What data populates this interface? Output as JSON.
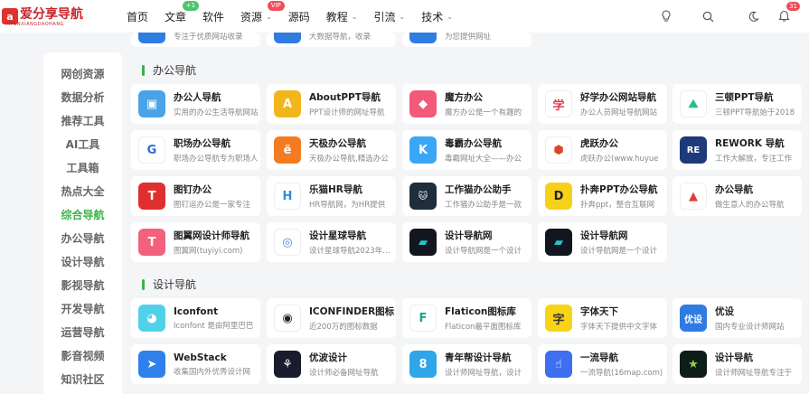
{
  "header": {
    "logo_text": "爱分享导航",
    "logo_sub": "AIFENXIANGDAOHANG",
    "nav": [
      {
        "label": "首页"
      },
      {
        "label": "文章",
        "badge": "+1",
        "badge_color": "#4cc66d"
      },
      {
        "label": "软件"
      },
      {
        "label": "资源",
        "badge": "VIP",
        "badge_color": "#ef4e5c",
        "chevron": true
      },
      {
        "label": "源码"
      },
      {
        "label": "教程",
        "chevron": true
      },
      {
        "label": "引流",
        "chevron": true
      },
      {
        "label": "技术",
        "chevron": true
      }
    ],
    "notification_count": "31"
  },
  "sidebar": {
    "items": [
      {
        "label": "网创资源"
      },
      {
        "label": "数据分析"
      },
      {
        "label": "推荐工具"
      },
      {
        "label": "AI工具"
      },
      {
        "label": "工具箱"
      },
      {
        "label": "热点大全"
      },
      {
        "label": "综合导航",
        "active": true
      },
      {
        "label": "办公导航"
      },
      {
        "label": "设计导航"
      },
      {
        "label": "影视导航"
      },
      {
        "label": "开发导航"
      },
      {
        "label": "运营导航"
      },
      {
        "label": "影音视频"
      },
      {
        "label": "知识社区"
      }
    ]
  },
  "partial_row": [
    {
      "desc": "专注于优质网站收录",
      "color": "#2f7de1"
    },
    {
      "desc": "大数据导航，收录",
      "color": "#2f7de1"
    },
    {
      "desc": "为您提供网址",
      "color": "#2f7de1"
    }
  ],
  "sections": [
    {
      "title": "办公导航",
      "cards": [
        {
          "title": "办公人导航",
          "desc": "实用的办公生活导航网站",
          "color": "#4aa3e8",
          "glyph": "▣"
        },
        {
          "title": "AboutPPT导航",
          "desc": "PPT设计师的网址导航",
          "color": "#f3b51c",
          "glyph": "A"
        },
        {
          "title": "魔方办公",
          "desc": "魔方办公是一个有趣的",
          "color": "#f25a7a",
          "glyph": "◆"
        },
        {
          "title": "好学办公网站导航",
          "desc": "办公人员网址导航网站",
          "color": "#ffffff",
          "glyph": "学",
          "fg": "#e63a4e"
        },
        {
          "title": "三顿PPT导航",
          "desc": "三顿PPT导航始于2018",
          "color": "#ffffff",
          "glyph": "⛰",
          "fg": "#22c08a"
        },
        {
          "title": "职场办公导航",
          "desc": "职场办公导航专为职场人",
          "color": "#ffffff",
          "glyph": "G",
          "fg": "#2c6fd6"
        },
        {
          "title": "天极办公导航",
          "desc": "天极办公导航,精选办公",
          "color": "#f57b22",
          "glyph": "ë"
        },
        {
          "title": "毒霸办公导航",
          "desc": "毒霸网址大全——办公",
          "color": "#3aa7f5",
          "glyph": "K"
        },
        {
          "title": "虎跃办公",
          "desc": "虎跃办公(www.huyue",
          "color": "#ffffff",
          "glyph": "⬢",
          "fg": "#d9482b"
        },
        {
          "title": "REWORK 导航",
          "desc": "工作大解放，专注工作",
          "color": "#1e3a7b",
          "glyph": "RE"
        },
        {
          "title": "图钉办公",
          "desc": "图钉运办公是一家专注",
          "color": "#e02f2f",
          "glyph": "T"
        },
        {
          "title": "乐猫HR导航",
          "desc": "HR导航网，为HR提供",
          "color": "#ffffff",
          "glyph": "H",
          "fg": "#2d8de0"
        },
        {
          "title": "工作猫办公助手",
          "desc": "工作猫办公助手是一款",
          "color": "#1f2d3d",
          "glyph": "🐱"
        },
        {
          "title": "扑奔PPT办公导航",
          "desc": "扑奔ppt，整合互联网",
          "color": "#f6d11a",
          "glyph": "D",
          "fg": "#222"
        },
        {
          "title": "办公导航",
          "desc": "做生意人的办公导航",
          "color": "#ffffff",
          "glyph": "▲",
          "fg": "#e33a3a"
        },
        {
          "title": "图翼网设计师导航",
          "desc": "图翼网(tuyiyi.com)",
          "color": "#f2627d",
          "glyph": "T"
        },
        {
          "title": "设计星球导航",
          "desc": "设计星球导航2023年上线",
          "color": "#ffffff",
          "glyph": "◎",
          "fg": "#4f86e8"
        },
        {
          "title": "设计导航网",
          "desc": "设计导航网是一个设计",
          "color": "#12161e",
          "glyph": "▰",
          "fg": "#27c2c6"
        },
        {
          "title": "设计导航网",
          "desc": "设计导航网是一个设计",
          "color": "#12161e",
          "glyph": "▰",
          "fg": "#27c2c6"
        }
      ]
    },
    {
      "title": "设计导航",
      "cards": [
        {
          "title": "Iconfont",
          "desc": "Iconfont 是由阿里巴巴",
          "color": "#4fd1e8",
          "glyph": "◕"
        },
        {
          "title": "ICONFINDER图标",
          "desc": "近200万的图标数据",
          "color": "#ffffff",
          "glyph": "◉",
          "fg": "#222"
        },
        {
          "title": "Flaticon图标库",
          "desc": "Flaticon最平面图标库",
          "color": "#ffffff",
          "glyph": "F",
          "fg": "#17a589"
        },
        {
          "title": "字体天下",
          "desc": "字体天下提供中文字体",
          "color": "#f7d417",
          "glyph": "字",
          "fg": "#333"
        },
        {
          "title": "优设",
          "desc": "国内专业设计师网站",
          "color": "#2f7be3",
          "glyph": "优设"
        },
        {
          "title": "WebStack",
          "desc": "收集国内外优秀设计网",
          "color": "#2f80ed",
          "glyph": "➤"
        },
        {
          "title": "优波设计",
          "desc": "设计师必备网址导航",
          "color": "#1b1b2e",
          "glyph": "⚘"
        },
        {
          "title": "青年帮设计导航",
          "desc": "设计师网址导航，设计",
          "color": "#2fa6e8",
          "glyph": "8"
        },
        {
          "title": "一流导航",
          "desc": "一流导航(16map.com)",
          "color": "#3d6ff0",
          "glyph": "☝"
        },
        {
          "title": "设计导航",
          "desc": "设计师网址导航专注于",
          "color": "#0f1d1a",
          "glyph": "★",
          "fg": "#8fd14f"
        }
      ]
    }
  ]
}
